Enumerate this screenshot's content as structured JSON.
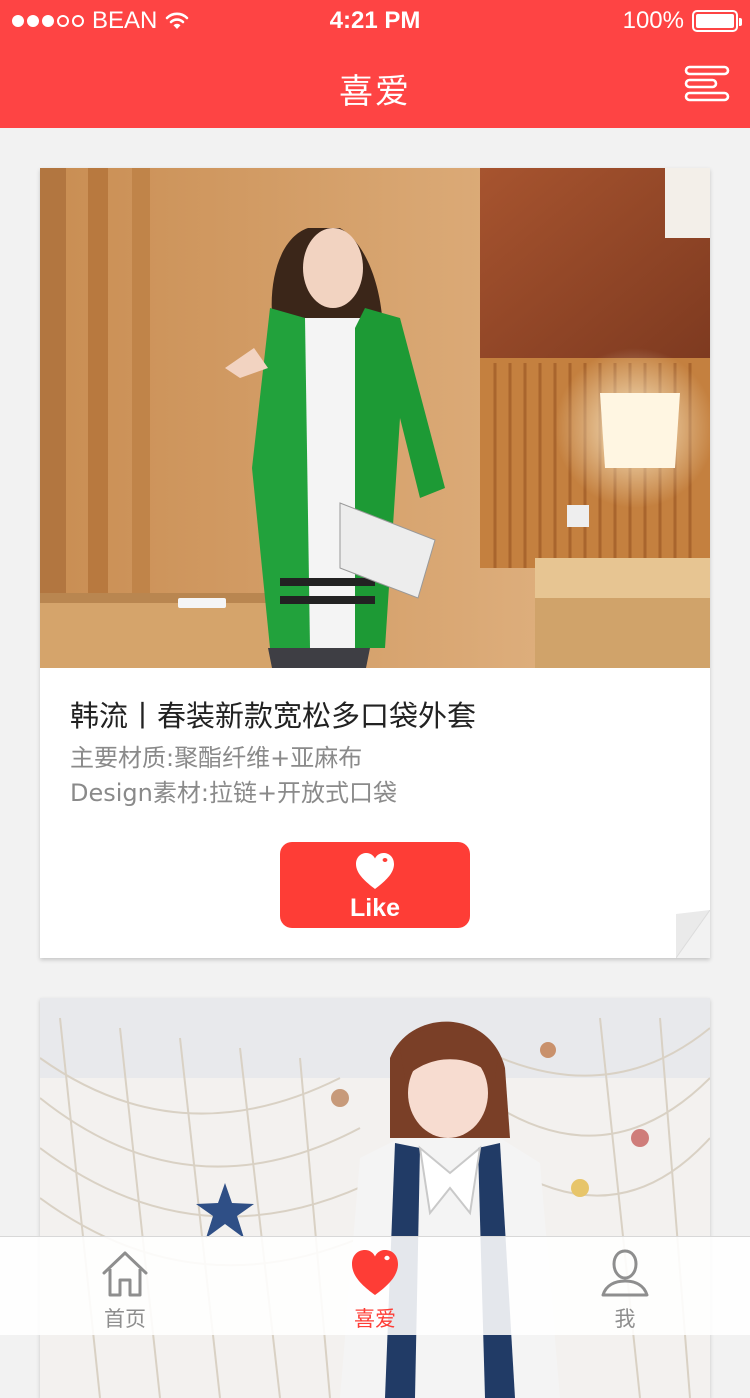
{
  "status_bar": {
    "carrier": "BEAN",
    "time": "4:21 PM",
    "battery": "100%",
    "battery_level": 1.0,
    "signal_bars_filled": 3,
    "signal_bars_total": 5
  },
  "header": {
    "title": "喜爱",
    "menu_icon": "menu-icon"
  },
  "cards": [
    {
      "image_icon": "product-photo",
      "title": "韩流丨春装新款宽松多口袋外套",
      "material": "主要材质:聚酯纤维+亚麻布",
      "design": "Design素材:拉链+开放式口袋",
      "like_label": "Like",
      "like_icon": "heart-icon"
    },
    {
      "image_icon": "product-photo"
    }
  ],
  "tab_bar": {
    "tabs": [
      {
        "label": "首页",
        "icon": "home-icon",
        "active": false
      },
      {
        "label": "喜爱",
        "icon": "heart-icon",
        "active": true
      },
      {
        "label": "我",
        "icon": "user-icon",
        "active": false
      }
    ]
  },
  "colors": {
    "brand": "#fe4444",
    "accent": "#fe3d36",
    "background": "#f2f2f2",
    "muted_text": "#8a8a8a"
  }
}
